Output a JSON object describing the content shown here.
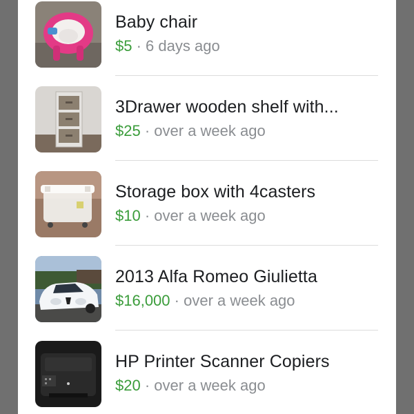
{
  "listings": [
    {
      "title": "Baby chair",
      "price": "$5",
      "separator": " · ",
      "age": "6 days ago",
      "image": "baby-chair-photo"
    },
    {
      "title": "3Drawer wooden shelf with...",
      "price": "$25",
      "separator": " · ",
      "age": "over a week ago",
      "image": "drawer-shelf-photo"
    },
    {
      "title": "Storage box with 4casters",
      "price": "$10",
      "separator": " · ",
      "age": "over a week ago",
      "image": "storage-box-photo"
    },
    {
      "title": "2013 Alfa Romeo Giulietta",
      "price": "$16,000",
      "separator": " · ",
      "age": "over a week ago",
      "image": "car-photo"
    },
    {
      "title": "HP Printer Scanner Copiers",
      "price": "$20",
      "separator": " · ",
      "age": "over a week ago",
      "image": "printer-photo"
    }
  ],
  "colors": {
    "price": "#3a9c3a",
    "secondary_text": "#8a8d91",
    "title_text": "#1c1e21",
    "divider": "#dcdcdc",
    "background": "#707070",
    "panel": "#ffffff"
  }
}
